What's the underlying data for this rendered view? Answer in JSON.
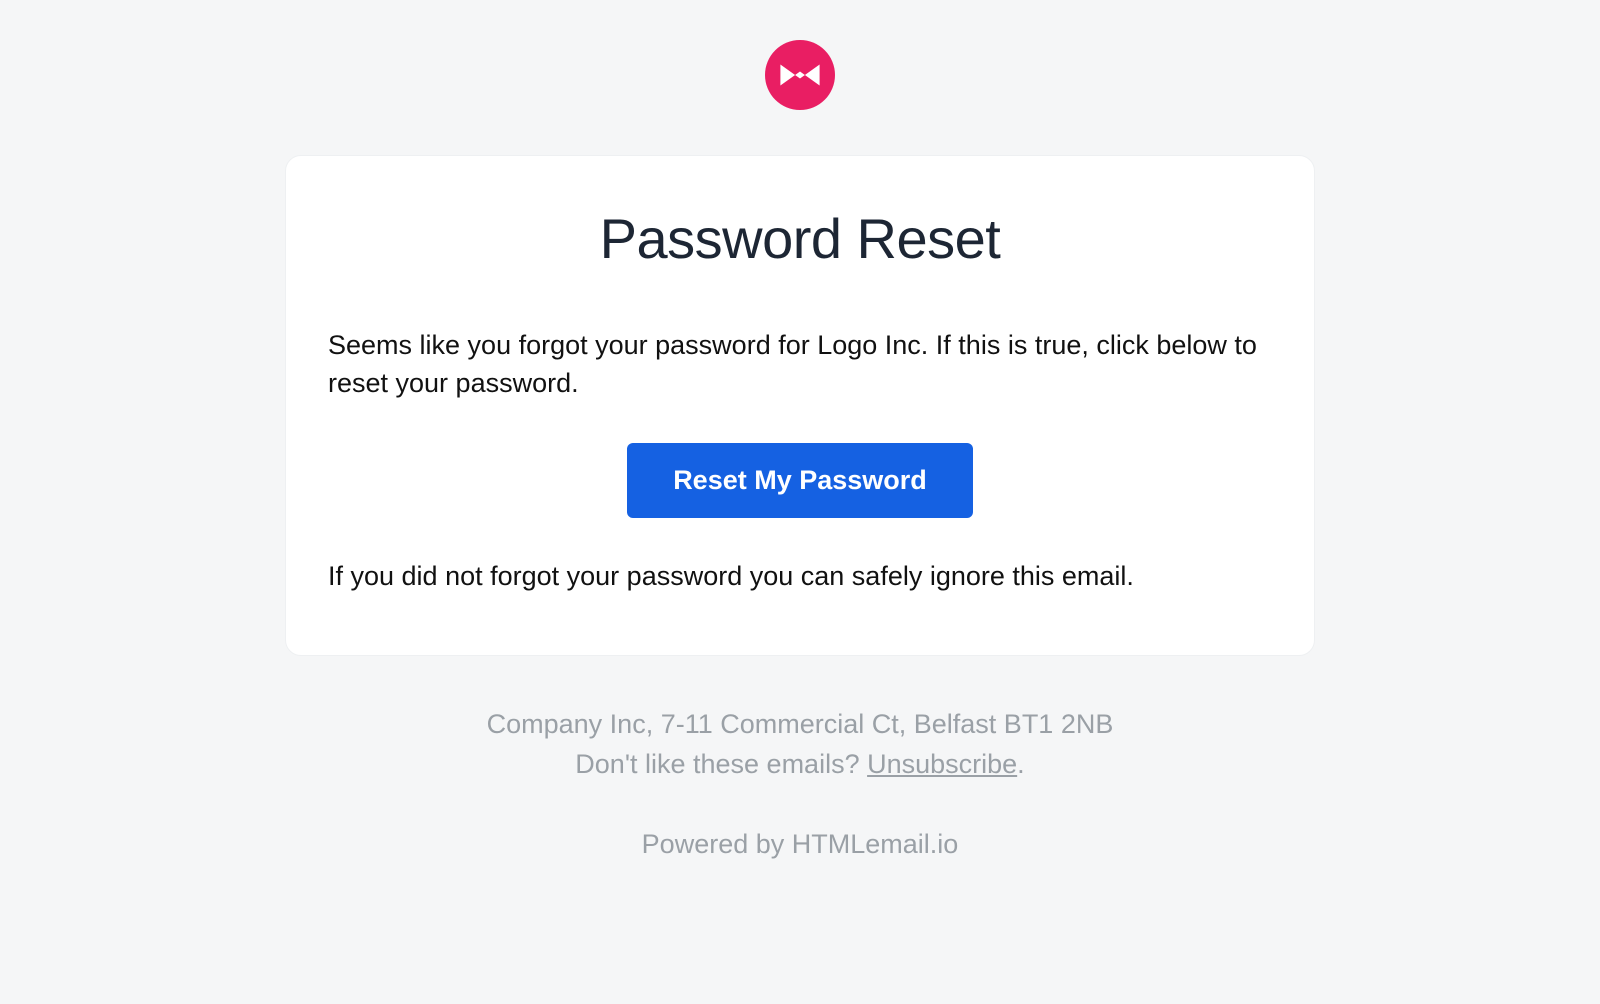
{
  "header": {
    "logo_name": "bowtie-logo-icon",
    "logo_color": "#e91e63"
  },
  "card": {
    "heading": "Password Reset",
    "intro_text": "Seems like you forgot your password for Logo Inc. If this is true, click below to reset your password.",
    "button_label": "Reset My Password",
    "ignore_text": "If you did not forgot your password you can safely ignore this email."
  },
  "footer": {
    "address": "Company Inc, 7-11 Commercial Ct, Belfast BT1 2NB",
    "unsubscribe_prompt": "Don't like these emails? ",
    "unsubscribe_label": "Unsubscribe",
    "unsubscribe_suffix": ".",
    "powered_prefix": "Powered by ",
    "powered_label": "HTMLemail.io"
  }
}
